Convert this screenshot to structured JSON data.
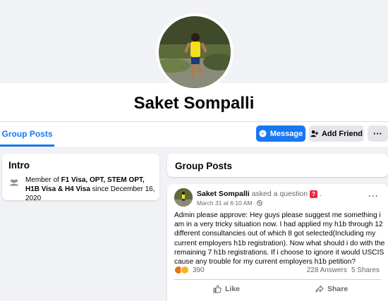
{
  "profile": {
    "name": "Saket Sompalli"
  },
  "tabs": {
    "group_posts": "Group Posts"
  },
  "actions": {
    "message": "Message",
    "add_friend": "Add Friend",
    "more": "···"
  },
  "intro": {
    "title": "Intro",
    "member_prefix": "Member of ",
    "group_name": "F1 Visa, OPT, STEM OPT, H1B Visa & H4 Visa",
    "member_suffix": " since December 16, 2020"
  },
  "group_posts_section": {
    "title": "Group Posts"
  },
  "post": {
    "author": "Saket Sompalli",
    "action": "asked a question",
    "badge": "?",
    "suffix": ".",
    "date": "March 31 at 6:10 AM",
    "separator": "·",
    "more": "···",
    "body": "Admin please approve: Hey guys please suggest me something i am in a very tricky situation now. I had applied my h1b through 12 different consultancies out of which 8 got selected(Including my current employers h1b registration). Now what should i do with the remaining 7 h1b registrations. If i choose to ignore it would USCIS cause any trouble for my current employers h1b petition?",
    "reaction_count": "390",
    "answers": "228 Answers",
    "shares": "5 Shares",
    "like_label": "Like",
    "share_label": "Share"
  },
  "colors": {
    "accent": "#1877f2",
    "background": "#f0f2f5",
    "secondary_text": "#65676b",
    "question_badge": "#f02849"
  },
  "icons": {
    "message": "messenger-icon",
    "add_friend": "add-friend-icon",
    "intro_members": "group-members-icon",
    "date_privacy": "globe-icon",
    "like": "thumbs-up-icon",
    "share": "share-arrow-icon"
  }
}
